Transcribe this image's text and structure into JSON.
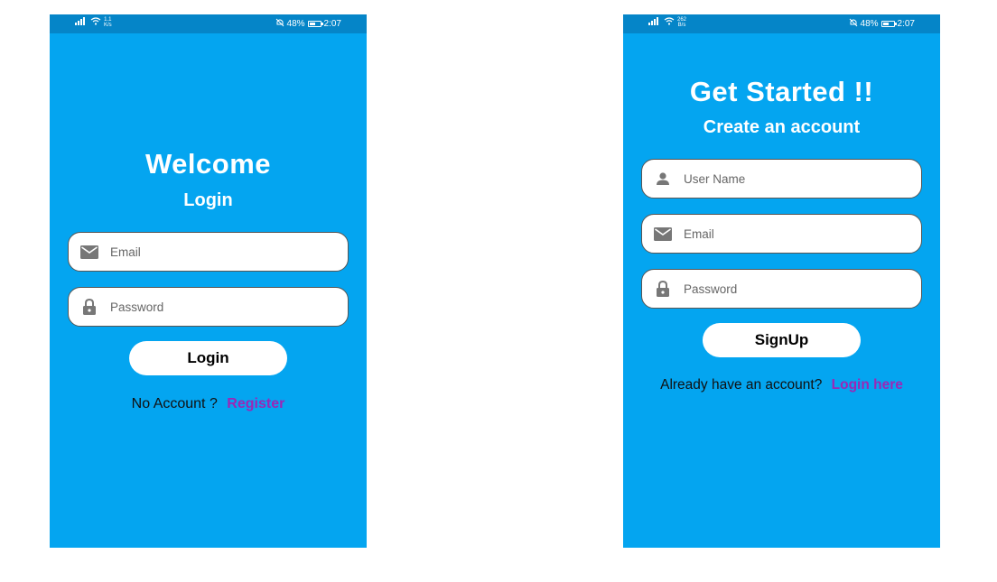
{
  "login_screen": {
    "status": {
      "net_speed_top": "1.1",
      "net_speed_unit": "K/s",
      "battery": "48%",
      "time": "2:07"
    },
    "title": "Welcome",
    "subtitle": "Login",
    "email_placeholder": "Email",
    "password_placeholder": "Password",
    "login_button": "Login",
    "no_account_text": "No Account ?",
    "register_link": "Register"
  },
  "signup_screen": {
    "status": {
      "net_speed_top": "262",
      "net_speed_unit": "B/s",
      "battery": "48%",
      "time": "2:07"
    },
    "title": "Get Started !!",
    "subtitle": "Create an account",
    "username_placeholder": "User Name",
    "email_placeholder": "Email",
    "password_placeholder": "Password",
    "signup_button": "SignUp",
    "have_account_text": "Already have an account?",
    "login_link": "Login here"
  },
  "icons": {
    "user": "user-icon",
    "email": "email-icon",
    "lock": "lock-icon",
    "wifi": "wifi-icon",
    "signal": "signal-icon",
    "mute": "mute-icon",
    "battery": "battery-icon"
  },
  "colors": {
    "background": "#04a5f0",
    "statusbar": "#0585c8",
    "link": "#9b27b6",
    "field_bg": "#ffffff",
    "icon": "#777777"
  }
}
